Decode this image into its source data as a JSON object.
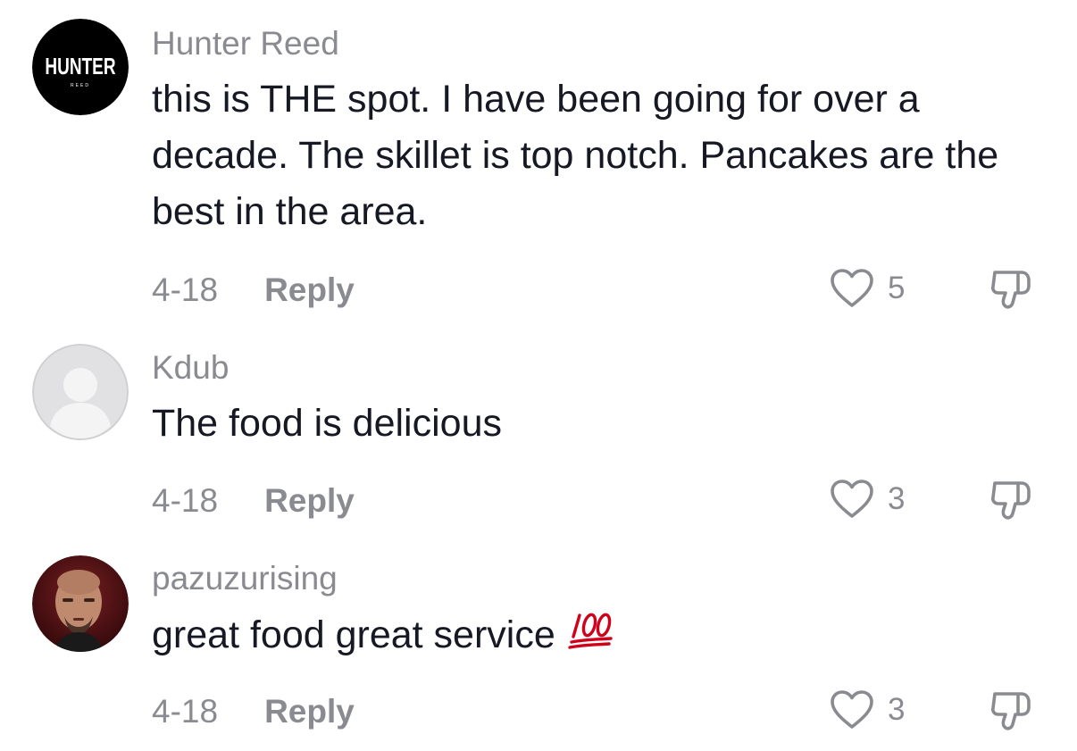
{
  "colors": {
    "secondary_text": "#8a8b91",
    "primary_text": "#161823",
    "emoji_red": "#d0021b"
  },
  "comments": [
    {
      "username": "Hunter Reed",
      "avatar_icon": "hunter-reed-logo-avatar",
      "avatar_logo_text": "HUNTER",
      "avatar_logo_subtext": "REED",
      "text": "this is THE spot. I have been going for over a decade. The skillet is top notch. Pancakes are the best in the area.",
      "date": "4-18",
      "reply_label": "Reply",
      "like_count": "5"
    },
    {
      "username": "Kdub",
      "avatar_icon": "default-user-avatar",
      "text": "The food is delicious",
      "date": "4-18",
      "reply_label": "Reply",
      "like_count": "3"
    },
    {
      "username": "pazuzurising",
      "avatar_icon": "user-photo-avatar",
      "text": "great food great service",
      "emoji": "hundred-points-emoji",
      "date": "4-18",
      "reply_label": "Reply",
      "like_count": "3"
    }
  ]
}
